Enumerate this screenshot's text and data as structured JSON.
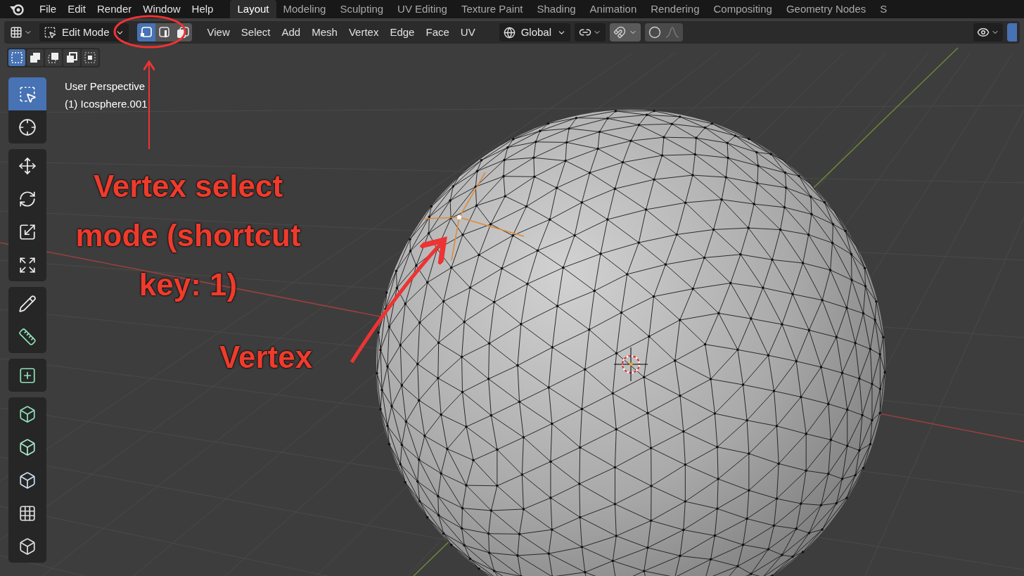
{
  "menu_bar": {
    "menus": [
      "File",
      "Edit",
      "Render",
      "Window",
      "Help"
    ]
  },
  "workspace_tabs": [
    {
      "label": "Layout",
      "selected": true
    },
    {
      "label": "Modeling",
      "selected": false
    },
    {
      "label": "Sculpting",
      "selected": false
    },
    {
      "label": "UV Editing",
      "selected": false
    },
    {
      "label": "Texture Paint",
      "selected": false
    },
    {
      "label": "Shading",
      "selected": false
    },
    {
      "label": "Animation",
      "selected": false
    },
    {
      "label": "Rendering",
      "selected": false
    },
    {
      "label": "Compositing",
      "selected": false
    },
    {
      "label": "Geometry Nodes",
      "selected": false
    },
    {
      "label": "S",
      "selected": false
    }
  ],
  "header": {
    "mode": "Edit Mode",
    "select_modes": [
      {
        "kind": "vertex",
        "selected": true
      },
      {
        "kind": "edge",
        "selected": false
      },
      {
        "kind": "face",
        "selected": false
      }
    ],
    "menus": [
      "View",
      "Select",
      "Add",
      "Mesh",
      "Vertex",
      "Edge",
      "Face",
      "UV"
    ],
    "orientation": "Global",
    "snap": {
      "on": true
    },
    "proportional_editing": {
      "on": true
    }
  },
  "box_select_modes": [
    {
      "kind": "new",
      "selected": true
    },
    {
      "kind": "extend",
      "selected": false
    },
    {
      "kind": "subtract",
      "selected": false
    },
    {
      "kind": "invert",
      "selected": false
    },
    {
      "kind": "intersect",
      "selected": false
    }
  ],
  "tool_groups": [
    {
      "tools": [
        {
          "kind": "select",
          "selected": true
        },
        {
          "kind": "cursor",
          "selected": false
        }
      ]
    },
    {
      "tools": [
        {
          "kind": "move",
          "selected": false
        },
        {
          "kind": "rotate",
          "selected": false
        },
        {
          "kind": "scale",
          "selected": false
        },
        {
          "kind": "transform",
          "selected": false
        }
      ]
    },
    {
      "tools": [
        {
          "kind": "annotate",
          "selected": false
        },
        {
          "kind": "measure",
          "selected": false
        }
      ]
    },
    {
      "tools": [
        {
          "kind": "add_cube",
          "selected": false
        }
      ]
    },
    {
      "tools": [
        {
          "kind": "extrude",
          "selected": false
        },
        {
          "kind": "inset",
          "selected": false
        },
        {
          "kind": "bevel",
          "selected": false
        },
        {
          "kind": "loop_cut",
          "selected": false
        },
        {
          "kind": "poly_build",
          "selected": false
        }
      ]
    }
  ],
  "viewport": {
    "view_name": "User Perspective",
    "object_name": "(1) Icosphere.001"
  },
  "annotations": [
    {
      "kind": "callout",
      "text": "Vertex select mode (shortcut key: 1)"
    },
    {
      "kind": "label",
      "text": "Vertex"
    }
  ]
}
